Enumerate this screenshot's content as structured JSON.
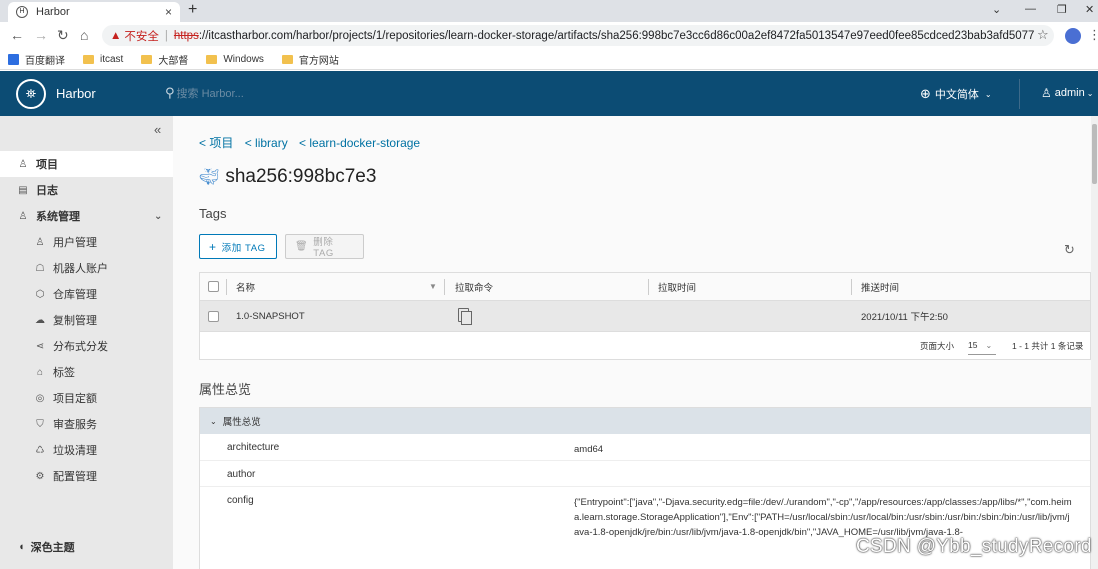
{
  "browser": {
    "tab_title": "Harbor",
    "tab_favicon": "H",
    "new_tab": "+",
    "close_tab": "×",
    "win_controls": [
      "⌄",
      "—",
      "❐",
      "✕"
    ],
    "nav": [
      "←",
      "→",
      "↻",
      "⌂"
    ],
    "security_label": "不安全",
    "url_scheme": "https",
    "url_rest": "://itcastharbor.com/harbor/projects/1/repositories/learn-docker-storage/artifacts/sha256:998bc7e3cc6d86c00a2ef8472fa5013547e97eed0fee85cdced23bab3afd5077",
    "bookmarks": [
      "百度翻译",
      "itcast",
      "大部督",
      "Windows",
      "官方网站"
    ]
  },
  "header": {
    "brand": "Harbor",
    "search_placeholder": "搜索 Harbor...",
    "language": "中文简体",
    "user": "admin"
  },
  "sidebar": {
    "collapse_glyph": "«",
    "items": [
      {
        "label": "项目",
        "icon": "projects-icon",
        "glyph": "♙"
      },
      {
        "label": "日志",
        "icon": "logs-icon",
        "glyph": "▤"
      },
      {
        "label": "系统管理",
        "icon": "admin-icon",
        "glyph": "♙"
      }
    ],
    "sub_items": [
      {
        "label": "用户管理",
        "icon": "users-icon",
        "glyph": "♙"
      },
      {
        "label": "机器人账户",
        "icon": "robot-icon",
        "glyph": "☖"
      },
      {
        "label": "仓库管理",
        "icon": "registry-icon",
        "glyph": "⬡"
      },
      {
        "label": "复制管理",
        "icon": "replication-icon",
        "glyph": "☁"
      },
      {
        "label": "分布式分发",
        "icon": "distribution-icon",
        "glyph": "⋖"
      },
      {
        "label": "标签",
        "icon": "label-icon",
        "glyph": "⌂"
      },
      {
        "label": "项目定额",
        "icon": "quota-icon",
        "glyph": "◎"
      },
      {
        "label": "审查服务",
        "icon": "scanner-icon",
        "glyph": "⛉"
      },
      {
        "label": "垃圾清理",
        "icon": "gc-icon",
        "glyph": "♺"
      },
      {
        "label": "配置管理",
        "icon": "config-icon",
        "glyph": "⚙"
      }
    ],
    "theme_label": "深色主题"
  },
  "main": {
    "breadcrumb": [
      "< 项目",
      "< library",
      "< learn-docker-storage"
    ],
    "artifact_title": "sha256:998bc7e3",
    "tags_heading": "Tags",
    "add_tag": "添加 TAG",
    "delete_tag": "删除 TAG",
    "columns": [
      "名称",
      "拉取命令",
      "拉取时间",
      "推送时间"
    ],
    "rows": [
      {
        "name": "1.0-SNAPSHOT",
        "pull_time": "",
        "push_time": "2021/10/11 下午2:50"
      }
    ],
    "page_size_label": "页面大小",
    "page_size": "15",
    "pagination": "1 - 1 共计 1 条记录",
    "attributes_heading": "属性总览",
    "accordion_title": "属性总览",
    "attributes": [
      {
        "key": "architecture",
        "value": "amd64"
      },
      {
        "key": "author",
        "value": ""
      },
      {
        "key": "config",
        "value": "{\"Entrypoint\":[\"java\",\"-Djava.security.edg=file:/dev/./urandom\",\"-cp\",\"/app/resources:/app/classes:/app/libs/*\",\"com.heima.learn.storage.StorageApplication\"],\"Env\":[\"PATH=/usr/local/sbin:/usr/local/bin:/usr/sbin:/usr/bin:/sbin:/bin:/usr/lib/jvm/java-1.8-openjdk/jre/bin:/usr/lib/jvm/java-1.8-openjdk/bin\",\"JAVA_HOME=/usr/lib/jvm/java-1.8-"
      }
    ]
  },
  "watermark": "CSDN @Ybb_studyRecord",
  "colors": {
    "header": "#0c4c74",
    "link": "#0072a3",
    "sidebar": "#e8e8e8"
  }
}
